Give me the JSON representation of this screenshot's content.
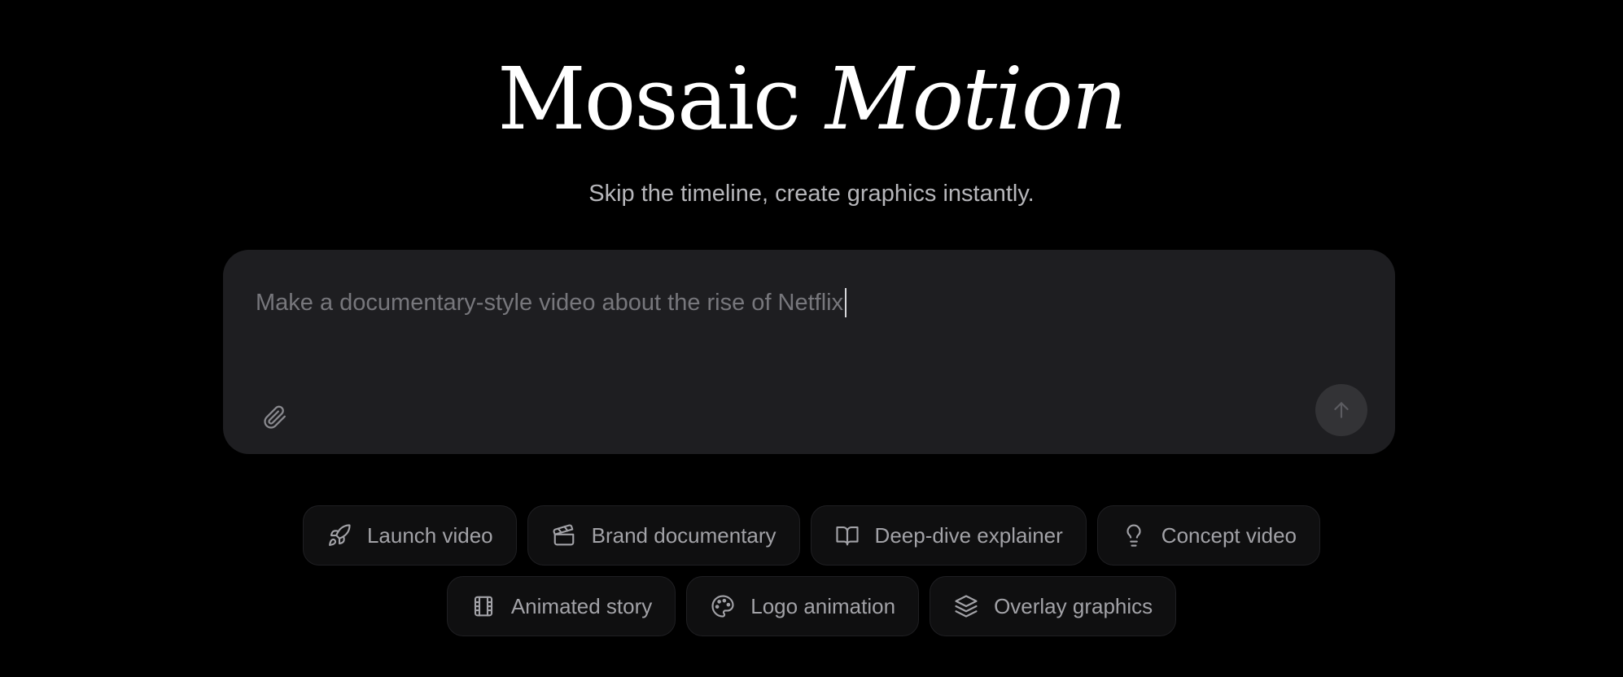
{
  "hero": {
    "title_main": "Mosaic",
    "title_italic": "Motion",
    "subtitle": "Skip the timeline, create graphics instantly."
  },
  "prompt": {
    "value": "Make a documentary-style video about the rise of Netflix",
    "attach_icon": "paperclip-icon",
    "send_icon": "arrow-up-icon"
  },
  "chips": {
    "row1": [
      {
        "label": "Launch video",
        "icon": "rocket-icon"
      },
      {
        "label": "Brand documentary",
        "icon": "clapperboard-icon"
      },
      {
        "label": "Deep-dive explainer",
        "icon": "open-book-icon"
      },
      {
        "label": "Concept video",
        "icon": "lightbulb-icon"
      }
    ],
    "row2": [
      {
        "label": "Animated story",
        "icon": "film-icon"
      },
      {
        "label": "Logo animation",
        "icon": "palette-icon"
      },
      {
        "label": "Overlay graphics",
        "icon": "layers-icon"
      }
    ]
  },
  "colors": {
    "background": "#000000",
    "prompt_bg": "#1e1e21",
    "chip_bg": "#0f0f10",
    "chip_text": "#a2a2a7",
    "subtitle": "#b6b6ba"
  }
}
